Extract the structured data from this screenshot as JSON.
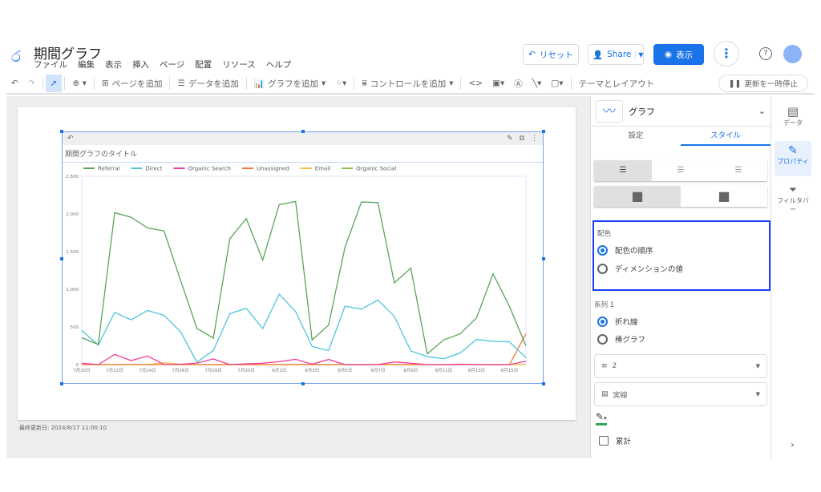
{
  "app": {
    "title": "期間グラフ",
    "menu": [
      "ファイル",
      "編集",
      "表示",
      "挿入",
      "ページ",
      "配置",
      "リソース",
      "ヘルプ"
    ]
  },
  "header": {
    "reset": "リセット",
    "share": "Share",
    "view": "表示"
  },
  "toolbar": {
    "add_page": "ページを追加",
    "add_data": "データを追加",
    "add_chart": "グラフを追加",
    "add_control": "コントロールを追加",
    "theme": "テーマとレイアウト",
    "pause": "更新を一時停止"
  },
  "footer": {
    "last_updated": "最終更新日: 2024/8/17 11:00:10"
  },
  "panel": {
    "chart_type": "グラフ",
    "tabs": [
      "設定",
      "スタイル"
    ],
    "active_tab": "スタイル",
    "color_section": "配色",
    "color_options": [
      "配色の順序",
      "ディメンションの値"
    ],
    "color_selected": 0,
    "series_section": "系列 1",
    "series_options": [
      "折れ線",
      "棒グラフ"
    ],
    "series_selected": 0,
    "line_weight": "2",
    "line_style": "実線",
    "line_color": "#34a853",
    "cumulative": "累計",
    "cumulative_checked": false
  },
  "sidebar": {
    "items": [
      "データ",
      "プロパティ",
      "フィルタバー"
    ],
    "active": 1
  },
  "chart_data": {
    "type": "line",
    "title": "期間グラフのタイトル",
    "categories": [
      "7月20日",
      "7月21日",
      "7月22日",
      "7月23日",
      "7月24日",
      "7月25日",
      "7月26日",
      "7月27日",
      "7月28日",
      "7月29日",
      "7月30日",
      "7月31日",
      "8月1日",
      "8月2日",
      "8月3日",
      "8月4日",
      "8月5日",
      "8月6日",
      "8月7日",
      "8月8日",
      "8月9日",
      "8月10日",
      "8月11日",
      "8月12日",
      "8月13日",
      "8月14日",
      "8月15日",
      "8月16日"
    ],
    "tick_labels": [
      "7月20日",
      "7月22日",
      "7月24日",
      "7月26日",
      "7月28日",
      "7月30日",
      "8月1日",
      "8月3日",
      "8月5日",
      "8月7日",
      "8月9日",
      "8月11日",
      "8月13日",
      "8月15日"
    ],
    "yticks": [
      "0",
      "500",
      "1,000",
      "1,500",
      "2,000",
      "2,500"
    ],
    "ylim": [
      0,
      2500
    ],
    "legend": "top",
    "series": [
      {
        "name": "Referral",
        "color": "#5aa45a",
        "values": [
          356,
          267,
          2016,
          1956,
          1814,
          1775,
          1120,
          480,
          352,
          1671,
          1938,
          1387,
          2123,
          2166,
          327,
          523,
          1558,
          2159,
          2151,
          1085,
          1280,
          142,
          327,
          409,
          622,
          1206,
          772,
          249
        ]
      },
      {
        "name": "Direct",
        "color": "#4ec6dc",
        "values": [
          455,
          260,
          693,
          594,
          718,
          654,
          437,
          32,
          188,
          676,
          747,
          477,
          935,
          704,
          242,
          185,
          775,
          736,
          857,
          640,
          181,
          107,
          78,
          153,
          334,
          309,
          302,
          92
        ]
      },
      {
        "name": "Organic Search",
        "color": "#f23c9c",
        "values": [
          18,
          0,
          135,
          53,
          114,
          0,
          5,
          20,
          75,
          0,
          10,
          18,
          40,
          70,
          5,
          68,
          0,
          0,
          0,
          35,
          18,
          0,
          0,
          5,
          0,
          0,
          0,
          45
        ]
      },
      {
        "name": "Unassigned",
        "color": "#f57c32",
        "values": [
          0,
          0,
          0,
          0,
          0,
          0,
          0,
          0,
          0,
          0,
          0,
          0,
          0,
          0,
          0,
          0,
          0,
          0,
          0,
          0,
          0,
          0,
          0,
          0,
          0,
          0,
          0,
          409
        ]
      },
      {
        "name": "Email",
        "color": "#fbbc45",
        "values": [
          0,
          0,
          0,
          0,
          0,
          25,
          5,
          0,
          0,
          0,
          0,
          0,
          0,
          0,
          0,
          0,
          0,
          0,
          0,
          0,
          0,
          0,
          0,
          0,
          0,
          0,
          0,
          0
        ]
      },
      {
        "name": "Organic Social",
        "color": "#8bc34a",
        "values": [
          0,
          0,
          0,
          0,
          0,
          0,
          0,
          0,
          0,
          0,
          0,
          0,
          0,
          0,
          0,
          0,
          0,
          0,
          0,
          0,
          0,
          0,
          0,
          0,
          0,
          0,
          0,
          0
        ]
      }
    ]
  }
}
